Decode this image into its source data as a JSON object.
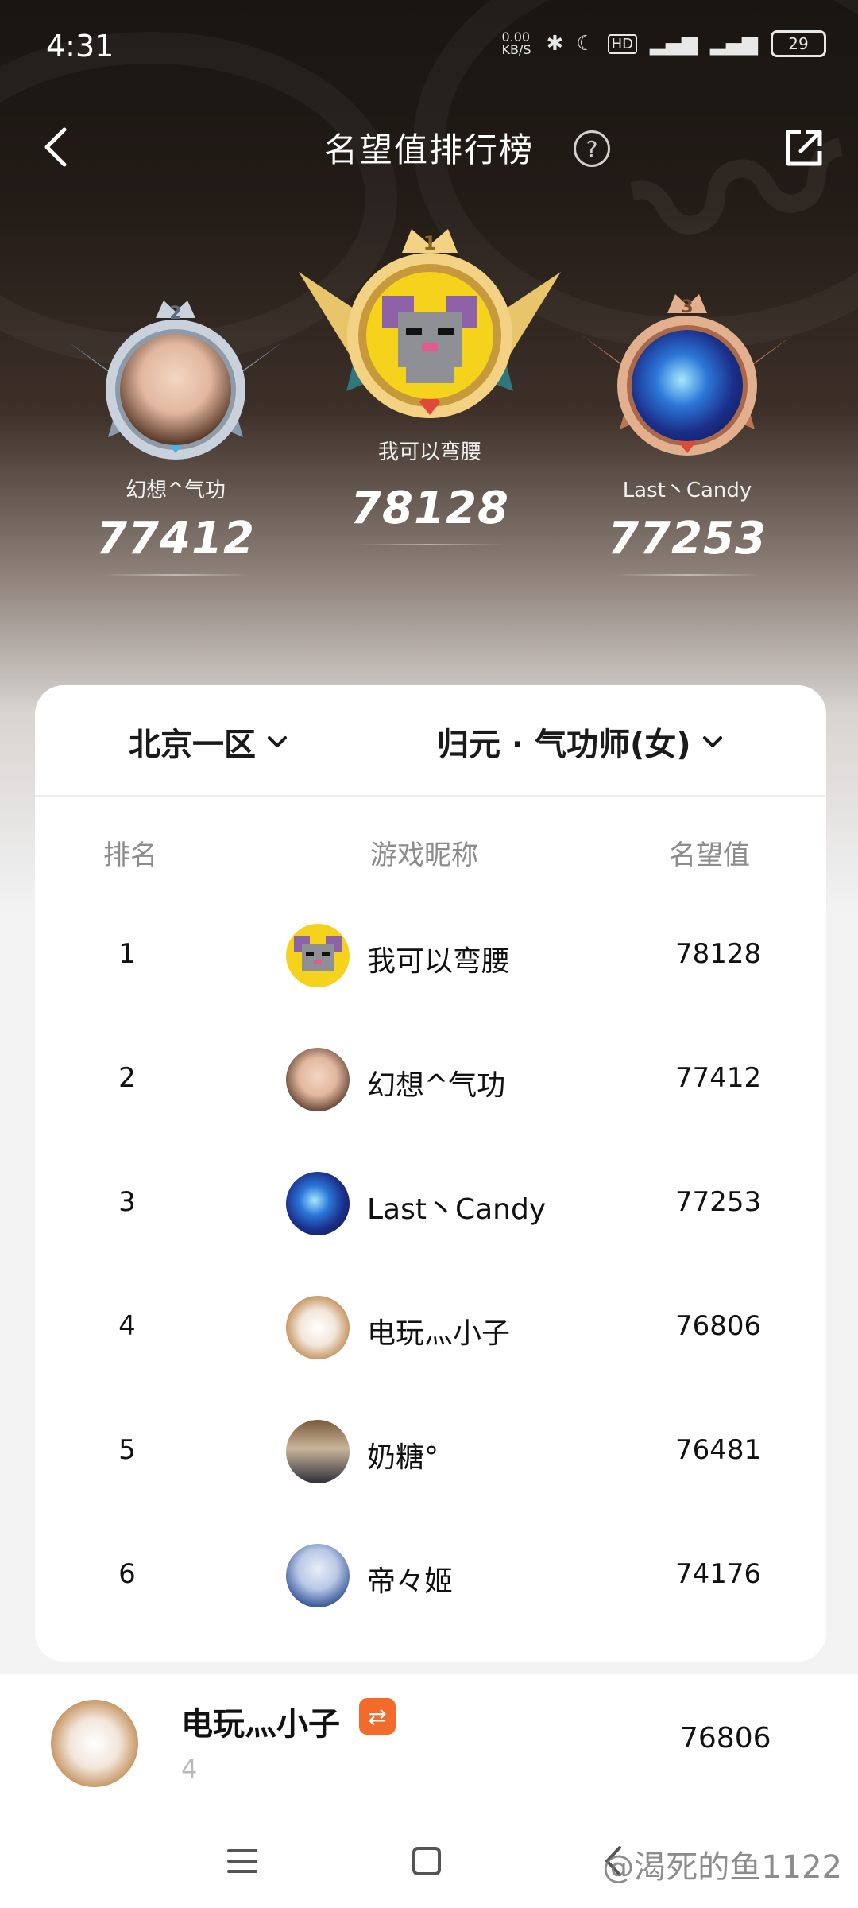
{
  "status_bar": {
    "time": "4:31",
    "network_speed": "0.00 KB/S",
    "battery": "29"
  },
  "header": {
    "title": "名望值排行榜",
    "help_icon": "question-circle-icon",
    "share_icon": "share-external-icon",
    "back_icon": "chevron-left-icon"
  },
  "podium": [
    {
      "rank": "2",
      "name": "幻想^气功",
      "score": "77412",
      "avatar": "boy-photo"
    },
    {
      "rank": "1",
      "name": "我可以弯腰",
      "score": "78128",
      "avatar": "pixel-mouse"
    },
    {
      "rank": "3",
      "name": "Last丶Candy",
      "score": "77253",
      "avatar": "blue-plasma"
    }
  ],
  "filters": {
    "server": "北京一区",
    "class": "归元 · 气功师(女)"
  },
  "table": {
    "headers": {
      "rank": "排名",
      "name": "游戏昵称",
      "value": "名望值"
    },
    "rows": [
      {
        "rank": "1",
        "name": "我可以弯腰",
        "value": "78128"
      },
      {
        "rank": "2",
        "name": "幻想^气功",
        "value": "77412"
      },
      {
        "rank": "3",
        "name": "Last丶Candy",
        "value": "77253"
      },
      {
        "rank": "4",
        "name": "电玩灬小子",
        "value": "76806"
      },
      {
        "rank": "5",
        "name": "奶糖°",
        "value": "76481"
      },
      {
        "rank": "6",
        "name": "帝々姬",
        "value": "74176"
      }
    ]
  },
  "mine": {
    "name": "电玩灬小子",
    "badge": "⇄",
    "rank": "4",
    "value": "76806"
  },
  "watermark": "@渴死的鱼1122",
  "colors": {
    "gold": "#e8c46a",
    "silver": "#c9d2dc",
    "bronze": "#d69a72",
    "badge_orange": "#f26b2a"
  }
}
